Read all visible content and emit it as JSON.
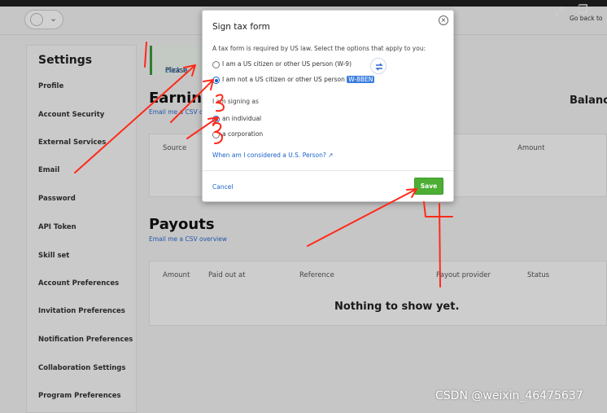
{
  "header": {
    "go_back": "Go back to"
  },
  "sidebar": {
    "title": "Settings",
    "items": [
      "Profile",
      "Account Security",
      "External Services",
      "Email",
      "Password",
      "API Token",
      "Skill set",
      "Account Preferences",
      "Invitation Preferences",
      "Notification Preferences",
      "Collaboration Settings",
      "Program Preferences"
    ]
  },
  "notice": {
    "prefix": "Please ",
    "link": "click h"
  },
  "earnings": {
    "title": "Earning",
    "csv_link": "Email me a CSV o",
    "columns": [
      "Source",
      "Amount"
    ],
    "balance": "Balance"
  },
  "payouts": {
    "title": "Payouts",
    "csv_link": "Email me a CSV overview",
    "columns": [
      "Amount",
      "Paid out at",
      "Reference",
      "Payout provider",
      "Status"
    ],
    "empty": "Nothing to show yet."
  },
  "modal": {
    "title": "Sign tax form",
    "close": "×",
    "description": "A tax form is required by US law. Select the options that apply to you:",
    "options": [
      {
        "label": "I am a US citizen or other US person (W-9)",
        "checked": false
      },
      {
        "label": "I am not a US citizen or other US person",
        "badge": "W-8BEN",
        "checked": true
      }
    ],
    "signing_as": "I am signing as",
    "signing_options": [
      {
        "label": "an individual",
        "checked": true
      },
      {
        "label": "a corporation",
        "checked": false
      }
    ],
    "us_person_link": "When am I considered a U.S. Person?",
    "cancel": "Cancel",
    "save": "Save"
  },
  "watermark": "CSDN @weixin_46475637",
  "colors": {
    "accent": "#1a62c9",
    "save": "#4caf34",
    "annotation": "#ff2a1a"
  }
}
